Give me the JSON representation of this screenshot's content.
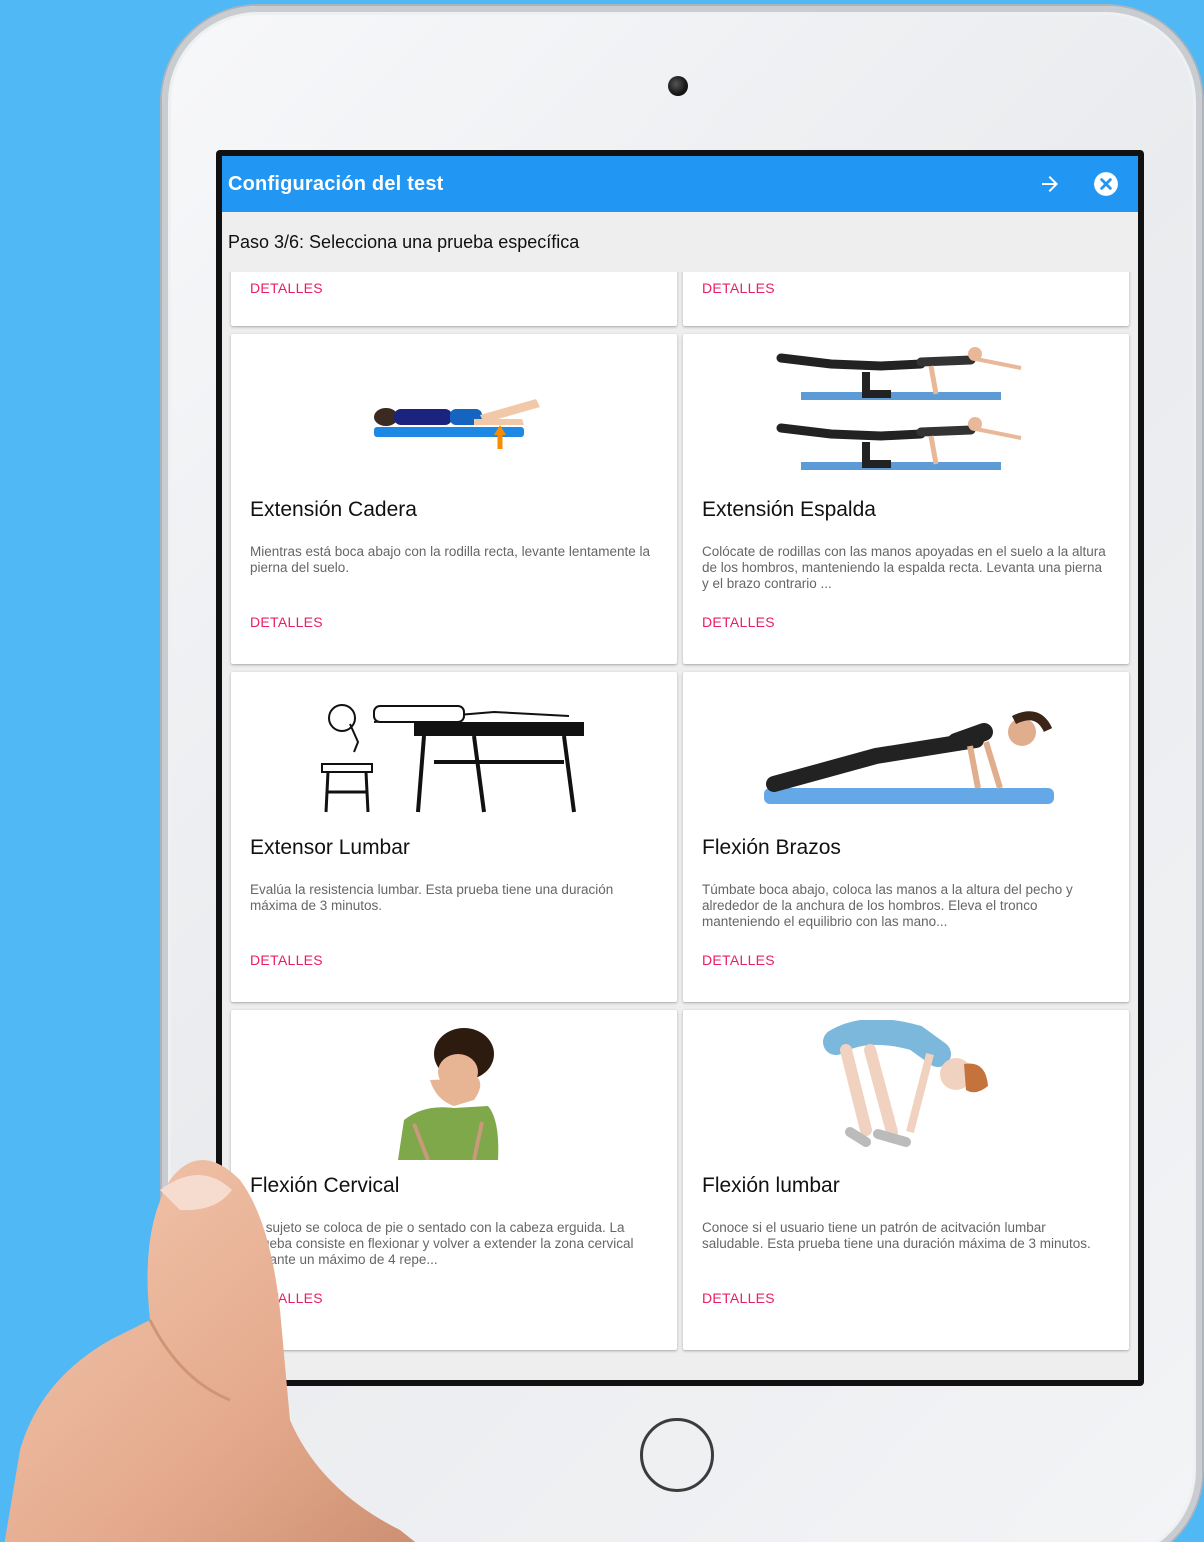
{
  "appbar": {
    "title": "Configuración del test",
    "next_icon": "arrow-right-icon",
    "close_icon": "close-circle-icon"
  },
  "step": {
    "text": "Paso 3/6: Selecciona una prueba específica"
  },
  "colors": {
    "appbar": "#2196f3",
    "accent": "#e91e63",
    "background": "#4fb8f5"
  },
  "top_cards": [
    {
      "details": "DETALLES"
    },
    {
      "details": "DETALLES"
    }
  ],
  "tests": [
    {
      "title": "Extensión Cadera",
      "desc": "Mientras está boca abajo con la rodilla recta, levante lentamente la pierna del suelo.",
      "details": "DETALLES",
      "image": "hip-extension-illustration"
    },
    {
      "title": "Extensión Espalda",
      "desc": "Colócate de rodillas con las manos apoyadas en el suelo a la altura de los hombros, manteniendo la espalda recta. Levanta una pierna y el brazo contrario ...",
      "details": "DETALLES",
      "image": "back-extension-illustration"
    },
    {
      "title": "Extensor Lumbar",
      "desc": "Evalúa la resistencia lumbar. Esta prueba tiene una duración máxima de 3 minutos.",
      "details": "DETALLES",
      "image": "lumbar-extensor-illustration"
    },
    {
      "title": "Flexión Brazos",
      "desc": "Túmbate boca abajo, coloca las manos a la altura del pecho y alrededor de la anchura de los hombros. Eleva el tronco manteniendo el equilibrio con las mano...",
      "details": "DETALLES",
      "image": "push-up-illustration"
    },
    {
      "title": "Flexión Cervical",
      "desc": "El sujeto se coloca de pie o sentado con la cabeza erguida. La prueba consiste en flexionar y volver a extender la zona cervical durante un máximo de 4 repe...",
      "details": "DETALLES",
      "image": "cervical-flexion-illustration"
    },
    {
      "title": "Flexión lumbar",
      "desc": "Conoce si el usuario tiene un patrón de acitvación lumbar saludable. Esta prueba tiene una duración máxima de 3 minutos.",
      "details": "DETALLES",
      "image": "lumbar-flexion-illustration"
    }
  ]
}
